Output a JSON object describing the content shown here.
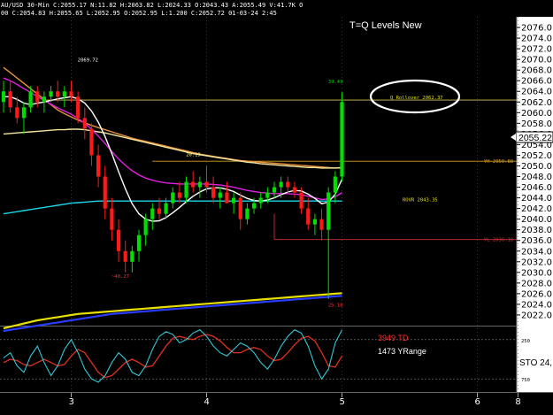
{
  "header": {
    "line1": "AU/USD  30-Min  C:2055.17  N:11.82  H:2063.82  L:2024.33  O:2043.43  A:2055.49  V:41.7K  O",
    "line2": "00  C:2054.83  H:2055.65  L:2052.95  O:2052.95  L:1.200  C:2052.72  01-03-24  2:45"
  },
  "title": "T=Q Levels New",
  "current_price_label": "2055.22",
  "colors": {
    "background": "#000000",
    "price_panel_bg": "#ffffff",
    "bull_candle": "#00e000",
    "bear_candle": "#ff1a1a",
    "ma_cyan": "#19d6e8",
    "ma_magenta": "#e020e0",
    "ma_orange": "#e8923a",
    "ma_lightyellow": "#f3e7a0",
    "ma_white": "#ffffff",
    "ma_blue": "#2a3cff",
    "ma_yellow": "#e8e000",
    "stoch_k": "#30c8d8",
    "stoch_d": "#e03020"
  },
  "chart_data": {
    "type": "candlestick",
    "symbol": "AU/USD",
    "timeframe": "30-Min",
    "ylim": [
      2020,
      2078
    ],
    "y_ticks": [
      2022,
      2024,
      2026,
      2028,
      2030,
      2032,
      2034,
      2036,
      2038,
      2040,
      2042,
      2044,
      2046,
      2048,
      2050,
      2052,
      2054,
      2056,
      2058,
      2060,
      2062,
      2064,
      2066,
      2068,
      2070,
      2072,
      2074,
      2076
    ],
    "x_tick_labels": [
      "3",
      "4",
      "5",
      "6",
      "8"
    ],
    "x_tick_index": [
      10,
      30,
      50,
      70,
      76
    ],
    "candles": [
      [
        2062,
        2066,
        2060,
        2064
      ],
      [
        2064,
        2066,
        2060,
        2061
      ],
      [
        2061,
        2063,
        2058,
        2059
      ],
      [
        2059,
        2062,
        2056,
        2061
      ],
      [
        2061,
        2065,
        2060,
        2064
      ],
      [
        2064,
        2065,
        2061,
        2062
      ],
      [
        2062,
        2064,
        2060,
        2063
      ],
      [
        2063,
        2065,
        2062,
        2064
      ],
      [
        2064,
        2066,
        2062,
        2063
      ],
      [
        2063,
        2065,
        2061,
        2064
      ],
      [
        2064,
        2066,
        2062,
        2063
      ],
      [
        2063,
        2064,
        2058,
        2059
      ],
      [
        2059,
        2061,
        2055,
        2057
      ],
      [
        2057,
        2058,
        2050,
        2052
      ],
      [
        2052,
        2054,
        2046,
        2048
      ],
      [
        2048,
        2050,
        2040,
        2042
      ],
      [
        2042,
        2044,
        2036,
        2038
      ],
      [
        2038,
        2040,
        2032,
        2034
      ],
      [
        2034,
        2036,
        2030,
        2032
      ],
      [
        2032,
        2035,
        2030,
        2034
      ],
      [
        2034,
        2038,
        2032,
        2037
      ],
      [
        2037,
        2041,
        2035,
        2040
      ],
      [
        2040,
        2043,
        2038,
        2042
      ],
      [
        2042,
        2044,
        2040,
        2041
      ],
      [
        2041,
        2044,
        2040,
        2043
      ],
      [
        2043,
        2046,
        2042,
        2045
      ],
      [
        2045,
        2047,
        2043,
        2044
      ],
      [
        2044,
        2048,
        2043,
        2047
      ],
      [
        2047,
        2049,
        2045,
        2046
      ],
      [
        2046,
        2048,
        2044,
        2047
      ],
      [
        2047,
        2050,
        2045,
        2046
      ],
      [
        2046,
        2048,
        2043,
        2044
      ],
      [
        2044,
        2046,
        2042,
        2045
      ],
      [
        2045,
        2047,
        2043,
        2043
      ],
      [
        2043,
        2045,
        2041,
        2044
      ],
      [
        2044,
        2045,
        2038,
        2040
      ],
      [
        2040,
        2043,
        2039,
        2042
      ],
      [
        2042,
        2044,
        2041,
        2043
      ],
      [
        2043,
        2045,
        2042,
        2044
      ],
      [
        2044,
        2046,
        2043,
        2045
      ],
      [
        2045,
        2047,
        2044,
        2046
      ],
      [
        2046,
        2048,
        2044,
        2047
      ],
      [
        2047,
        2048,
        2045,
        2046
      ],
      [
        2046,
        2047,
        2044,
        2045
      ],
      [
        2045,
        2046,
        2041,
        2042
      ],
      [
        2042,
        2044,
        2038,
        2039
      ],
      [
        2039,
        2041,
        2037,
        2040
      ],
      [
        2040,
        2042,
        2036,
        2038
      ],
      [
        2038,
        2046,
        2025,
        2045
      ],
      [
        2045,
        2049,
        2043,
        2048
      ],
      [
        2048,
        2063.82,
        2047,
        2062
      ]
    ],
    "moving_averages": [
      {
        "color_key": "ma_orange",
        "values": [
          2068.5,
          2067.5,
          2066.5,
          2065.5,
          2064.5,
          2063.5,
          2062.5,
          2061.5,
          2060.5,
          2059.8,
          2059.2,
          2058.6,
          2058.1,
          2057.6,
          2057.2,
          2056.8,
          2056.4,
          2056.0,
          2055.6,
          2055.2,
          2054.9,
          2054.6,
          2054.3,
          2054.0,
          2053.7,
          2053.4,
          2053.1,
          2052.8,
          2052.5,
          2052.2,
          2052.0,
          2051.8,
          2051.6,
          2051.4,
          2051.2,
          2051.0,
          2050.9,
          2050.8,
          2050.7,
          2050.6,
          2050.5,
          2050.4,
          2050.3,
          2050.2,
          2050.1,
          2050.0,
          2049.9,
          2049.8,
          2049.7,
          2049.6,
          2049.6
        ]
      },
      {
        "color_key": "ma_lightyellow",
        "values": [
          2056.0,
          2056.1,
          2056.2,
          2056.3,
          2056.4,
          2056.5,
          2056.6,
          2056.7,
          2056.8,
          2056.8,
          2056.9,
          2056.9,
          2056.8,
          2056.6,
          2056.4,
          2056.2,
          2055.9,
          2055.6,
          2055.3,
          2055.0,
          2054.7,
          2054.4,
          2054.1,
          2053.8,
          2053.5,
          2053.2,
          2052.9,
          2052.6,
          2052.3,
          2052.1,
          2051.9,
          2051.7,
          2051.5,
          2051.3,
          2051.1,
          2050.9,
          2050.7,
          2050.6,
          2050.4,
          2050.3,
          2050.2,
          2050.1,
          2050.0,
          2049.9,
          2049.8,
          2049.7,
          2049.7,
          2049.6,
          2049.6,
          2049.6,
          2049.7
        ]
      },
      {
        "color_key": "ma_magenta",
        "values": [
          2066.5,
          2066.0,
          2065.3,
          2064.5,
          2063.8,
          2063.0,
          2062.3,
          2061.6,
          2060.9,
          2060.3,
          2059.7,
          2058.9,
          2058.0,
          2056.9,
          2055.6,
          2054.2,
          2052.7,
          2051.3,
          2050.1,
          2049.1,
          2048.3,
          2047.7,
          2047.3,
          2047.0,
          2046.8,
          2046.7,
          2046.6,
          2046.6,
          2046.6,
          2046.6,
          2046.6,
          2046.5,
          2046.4,
          2046.2,
          2046.0,
          2045.7,
          2045.4,
          2045.2,
          2045.0,
          2044.9,
          2044.8,
          2044.8,
          2044.8,
          2044.7,
          2044.6,
          2044.3,
          2044.0,
          2043.7,
          2043.8,
          2044.2,
          2045.0
        ]
      },
      {
        "color_key": "ma_cyan",
        "values": [
          2041.0,
          2041.2,
          2041.4,
          2041.6,
          2041.8,
          2042.0,
          2042.2,
          2042.4,
          2042.6,
          2042.8,
          2043.0,
          2043.1,
          2043.2,
          2043.3,
          2043.4,
          2043.4,
          2043.4,
          2043.4,
          2043.4,
          2043.4,
          2043.4,
          2043.4,
          2043.4,
          2043.4,
          2043.4,
          2043.4,
          2043.4,
          2043.4,
          2043.4,
          2043.4,
          2043.4,
          2043.4,
          2043.4,
          2043.4,
          2043.4,
          2043.4,
          2043.4,
          2043.4,
          2043.4,
          2043.4,
          2043.4,
          2043.4,
          2043.4,
          2043.4,
          2043.4,
          2043.4,
          2043.4,
          2043.4,
          2043.4,
          2043.4,
          2043.4
        ]
      },
      {
        "color_key": "ma_white",
        "values": [
          2063.0,
          2063.0,
          2062.5,
          2061.8,
          2061.5,
          2061.8,
          2062.0,
          2062.3,
          2062.6,
          2062.8,
          2063.0,
          2062.6,
          2061.8,
          2060.3,
          2058.2,
          2055.5,
          2052.3,
          2048.9,
          2045.7,
          2042.9,
          2041.0,
          2040.0,
          2039.6,
          2039.7,
          2040.3,
          2041.2,
          2042.2,
          2043.3,
          2044.3,
          2045.1,
          2045.7,
          2045.9,
          2045.9,
          2045.6,
          2045.2,
          2044.5,
          2043.9,
          2043.5,
          2043.4,
          2043.6,
          2044.0,
          2044.6,
          2045.1,
          2045.4,
          2045.3,
          2044.7,
          2043.9,
          2042.9,
          2043.2,
          2044.7,
          2047.5
        ]
      },
      {
        "color_key": "ma_blue",
        "values": [
          2019.0,
          2019.2,
          2019.4,
          2019.6,
          2019.8,
          2020.0,
          2020.2,
          2020.4,
          2020.6,
          2020.8,
          2021.0,
          2021.2,
          2021.4,
          2021.6,
          2021.8,
          2022.0,
          2022.2,
          2022.3,
          2022.4,
          2022.5,
          2022.6,
          2022.7,
          2022.8,
          2022.9,
          2023.0,
          2023.1,
          2023.2,
          2023.3,
          2023.4,
          2023.5,
          2023.6,
          2023.7,
          2023.8,
          2023.9,
          2024.0,
          2024.1,
          2024.2,
          2024.3,
          2024.4,
          2024.5,
          2024.6,
          2024.7,
          2024.8,
          2024.9,
          2025.0,
          2025.1,
          2025.2,
          2025.3,
          2025.4,
          2025.5,
          2025.6
        ]
      },
      {
        "color_key": "ma_yellow",
        "values": [
          2019.5,
          2019.8,
          2020.1,
          2020.4,
          2020.7,
          2021.0,
          2021.2,
          2021.4,
          2021.6,
          2021.8,
          2022.0,
          2022.2,
          2022.3,
          2022.4,
          2022.5,
          2022.6,
          2022.7,
          2022.8,
          2022.9,
          2023.0,
          2023.1,
          2023.2,
          2023.3,
          2023.4,
          2023.5,
          2023.6,
          2023.7,
          2023.8,
          2023.9,
          2024.0,
          2024.1,
          2024.2,
          2024.3,
          2024.4,
          2024.5,
          2024.6,
          2024.7,
          2024.8,
          2024.9,
          2025.0,
          2025.1,
          2025.2,
          2025.3,
          2025.4,
          2025.5,
          2025.6,
          2025.7,
          2025.8,
          2025.9,
          2026.0,
          2026.1
        ]
      }
    ],
    "levels": [
      {
        "price": 2062.37,
        "color": "#d8c860",
        "from_index": 6,
        "label": ""
      },
      {
        "price": 2050.88,
        "color": "#d8a020",
        "from_index": 22,
        "label": "YH 2050.88"
      },
      {
        "price": 2036.18,
        "color": "#d03030",
        "from_index": 40,
        "label": "YL 2036.18"
      }
    ],
    "annotations": [
      {
        "text": "2069.72",
        "x_index": 12,
        "price": 2069.6,
        "color": "#ffffff"
      },
      {
        "text": "39.49",
        "x_index": 49,
        "price": 2065.5,
        "color": "#00d000"
      },
      {
        "text": "20.19",
        "x_index": 28,
        "price": 2051.8,
        "color": "#ffff80"
      },
      {
        "text": "ROVR 2043.35",
        "x_index": 60,
        "price": 2043.35,
        "color": "#e8e000"
      },
      {
        "text": "~40.27",
        "x_index": 17,
        "price": 2029.0,
        "color": "#ff3030"
      },
      {
        "text": "25.18",
        "x_index": 49,
        "price": 2023.6,
        "color": "#ff3030"
      }
    ],
    "oval_label": "Q Rollover 2062.37",
    "stochastic": {
      "k": [
        52,
        60,
        40,
        30,
        55,
        70,
        45,
        25,
        40,
        65,
        80,
        60,
        35,
        20,
        15,
        25,
        45,
        60,
        50,
        30,
        25,
        40,
        65,
        85,
        92,
        88,
        75,
        80,
        90,
        95,
        85,
        70,
        60,
        55,
        65,
        75,
        70,
        60,
        45,
        35,
        50,
        70,
        85,
        95,
        90,
        70,
        40,
        20,
        35,
        75,
        95
      ],
      "d": [
        45,
        50,
        48,
        42,
        40,
        45,
        50,
        45,
        40,
        42,
        55,
        65,
        60,
        45,
        30,
        22,
        25,
        35,
        45,
        50,
        45,
        38,
        40,
        55,
        70,
        82,
        85,
        82,
        80,
        85,
        88,
        85,
        78,
        68,
        60,
        60,
        65,
        68,
        65,
        55,
        48,
        50,
        60,
        72,
        82,
        85,
        78,
        60,
        40,
        38,
        55
      ],
      "levels": [
        20,
        80
      ],
      "tick_labels": [
        {
          "text": "250",
          "value": 80
        },
        {
          "text": "750",
          "value": 20
        }
      ],
      "label": "STO  24,"
    },
    "info_text_1": "3949 TD",
    "info_text_2": "1473 YRange"
  }
}
